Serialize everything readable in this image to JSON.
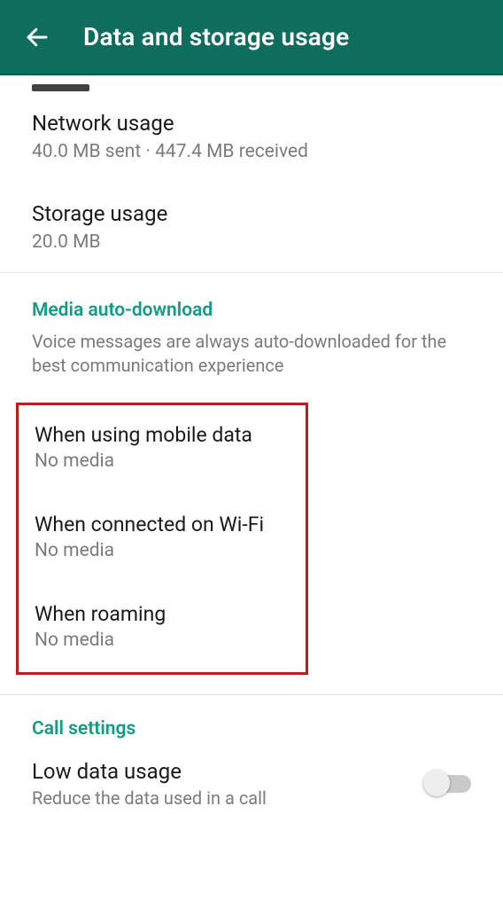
{
  "appbar": {
    "title": "Data and storage usage"
  },
  "usage": {
    "network": {
      "title": "Network usage",
      "sub": "40.0 MB sent · 447.4 MB received"
    },
    "storage": {
      "title": "Storage usage",
      "sub": "20.0 MB"
    }
  },
  "media": {
    "section_title": "Media auto-download",
    "section_desc": "Voice messages are always auto-downloaded for the best communication experience",
    "mobile": {
      "title": "When using mobile data",
      "sub": "No media"
    },
    "wifi": {
      "title": "When connected on Wi-Fi",
      "sub": "No media"
    },
    "roaming": {
      "title": "When roaming",
      "sub": "No media"
    }
  },
  "call": {
    "section_title": "Call settings",
    "low_data": {
      "title": "Low data usage",
      "sub": "Reduce the data used in a call"
    }
  }
}
